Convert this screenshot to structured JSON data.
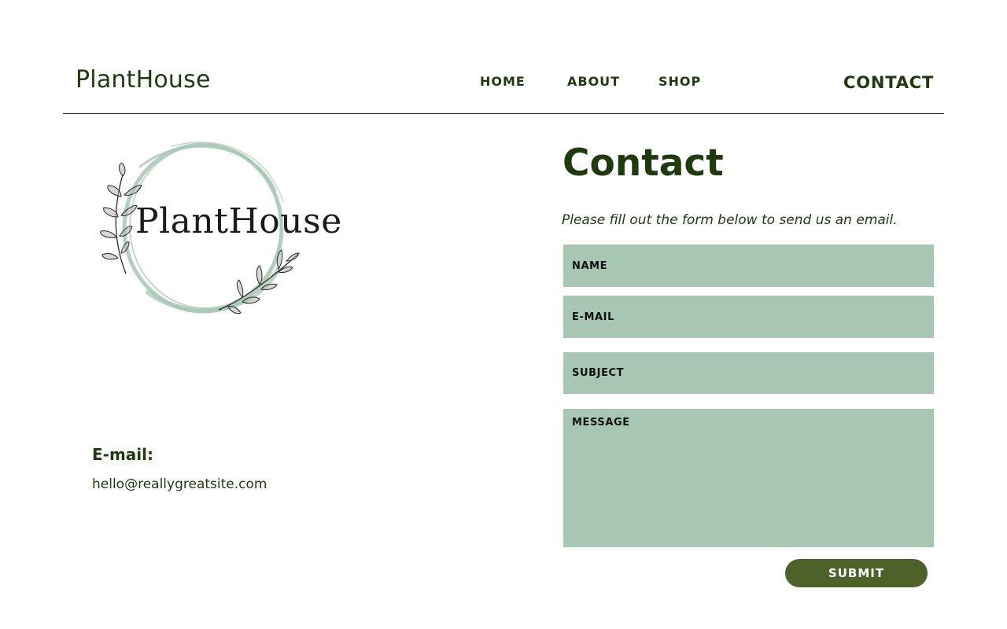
{
  "header": {
    "brand": "PlantHouse",
    "nav": {
      "home": "HOME",
      "about": "ABOUT",
      "shop": "SHOP",
      "contact": "CONTACT"
    }
  },
  "logo": {
    "text": "PlantHouse",
    "ring_color": "#a7c7b4",
    "leaf_icon": "olive-branch-icon"
  },
  "contact_info": {
    "email_heading": "E-mail:",
    "email_value": "hello@reallygreatsite.com"
  },
  "form": {
    "title": "Contact",
    "intro": "Please fill out the form below to send us an email.",
    "name_placeholder": "NAME",
    "email_placeholder": "E-MAIL",
    "subject_placeholder": "SUBJECT",
    "message_placeholder": "MESSAGE",
    "submit_label": "SUBMIT"
  },
  "colors": {
    "text_dark_green": "#1e3a0e",
    "field_green": "#a7c7b4",
    "button_green": "#4c6229"
  }
}
